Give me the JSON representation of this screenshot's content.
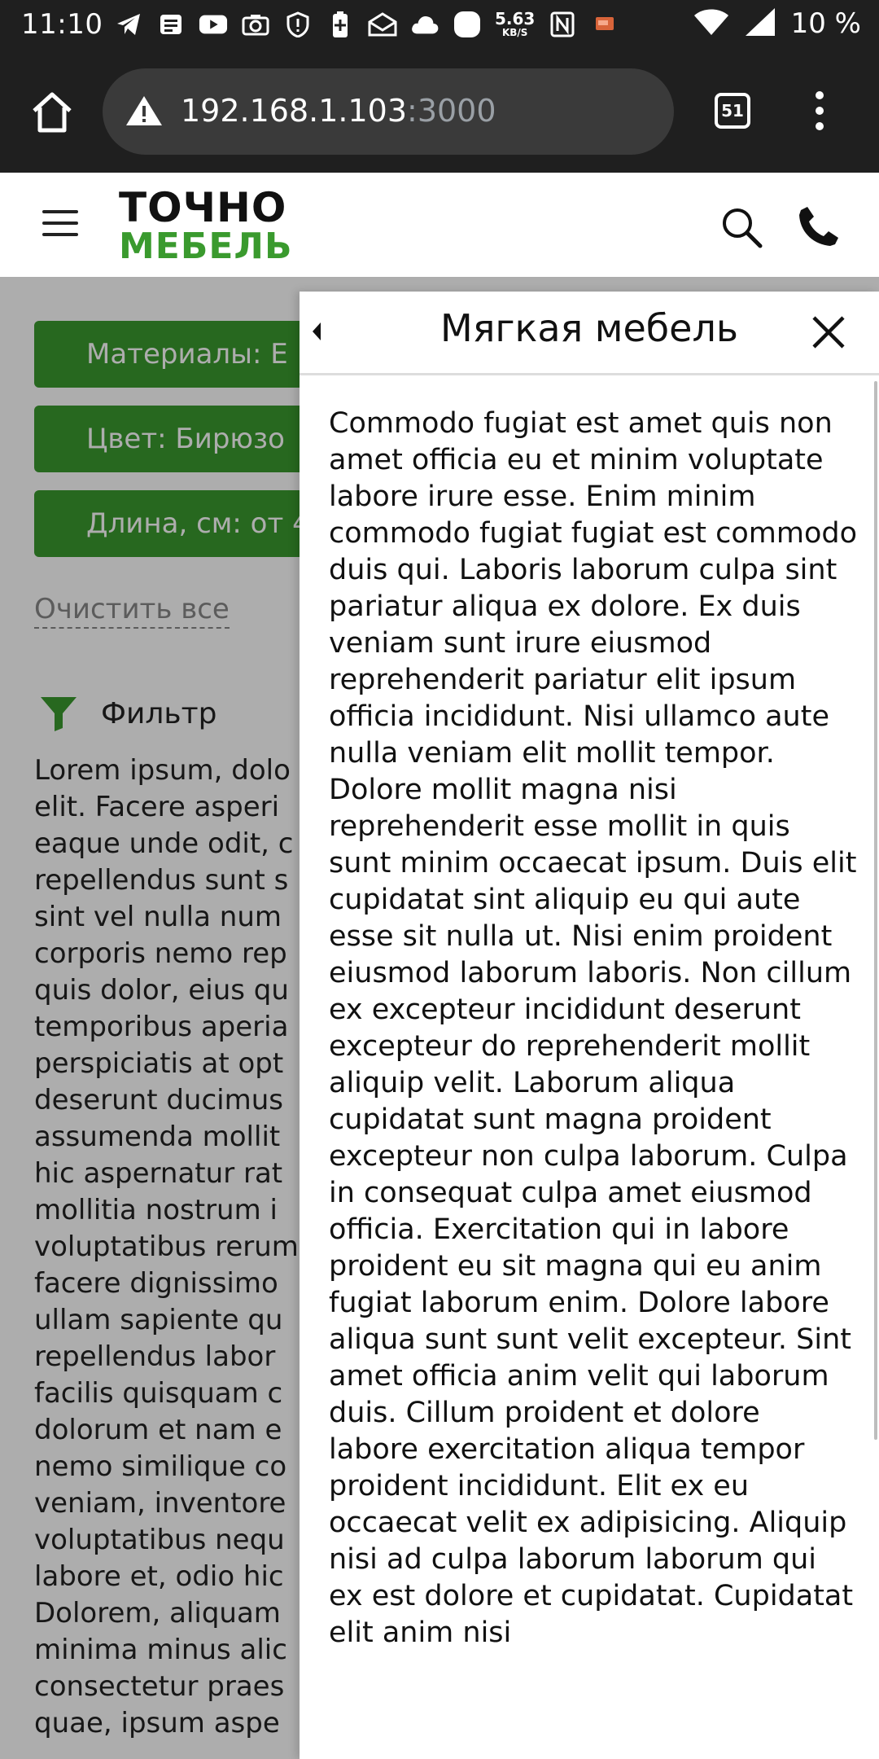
{
  "status_bar": {
    "time": "11:10",
    "speed_value": "5.63",
    "speed_unit": "KB/S",
    "battery": "10 %"
  },
  "browser": {
    "url_host": "192.168.1.103",
    "url_port": ":3000",
    "tab_count": "51"
  },
  "header": {
    "logo_top": "ТОЧНО",
    "logo_bottom": "МЕБЕЛЬ",
    "brand_color": "#3a9a2e"
  },
  "filters": {
    "chips": [
      "Материалы: Е",
      "Цвет: Бирюзо",
      "Длина, см: от 4"
    ],
    "clear_all": "Очистить все",
    "filter_label": "Фильтр"
  },
  "page_text": "Lorem ipsum, dolo\nelit. Facere asperi\neaque unde odit, c\nrepellendus sunt s\nsint vel nulla num\ncorporis nemo rep\nquis dolor, eius qu\ntemporibus aperia\nperspiciatis at opt\ndeserunt ducimus\nassumenda mollit\nhic aspernatur rat\nmollitia nostrum i\nvoluptatibus rerum\nfacere dignissimo\nullam sapiente qu\nrepellendus labor\nfacilis quisquam c\ndolorum et nam e\nnemo similique co\nveniam, inventore\nvoluptatibus nequ\nlabore et, odio hic\nDolorem, aliquam\nminima minus alic\nconsectetur praes\nquae, ipsum aspe",
  "drawer": {
    "title": "Мягкая мебель",
    "body": "Commodo fugiat est amet quis non amet officia eu et minim voluptate labore irure esse. Enim minim commodo fugiat fugiat est commodo duis qui. Laboris laborum culpa sint pariatur aliqua ex dolore. Ex duis veniam sunt irure eiusmod reprehenderit pariatur elit ipsum officia incididunt. Nisi ullamco aute nulla veniam elit mollit tempor. Dolore mollit magna nisi reprehenderit esse mollit in quis sunt minim occaecat ipsum. Duis elit cupidatat sint aliquip eu qui aute esse sit nulla ut. Nisi enim proident eiusmod laborum laboris. Non cillum ex excepteur incididunt deserunt excepteur do reprehenderit mollit aliquip velit. Laborum aliqua cupidatat sunt magna proident excepteur non culpa laborum. Culpa in consequat culpa amet eiusmod officia. Exercitation qui in labore proident eu sit magna qui eu anim fugiat laborum enim. Dolore labore aliqua sunt sunt velit excepteur. Sint amet officia anim velit qui laborum duis. Cillum proident et dolore labore exercitation aliqua tempor proident incididunt. Elit ex eu occaecat velit ex adipisicing. Aliquip nisi ad culpa laborum laborum qui ex est dolore et cupidatat. Cupidatat elit anim nisi"
  }
}
